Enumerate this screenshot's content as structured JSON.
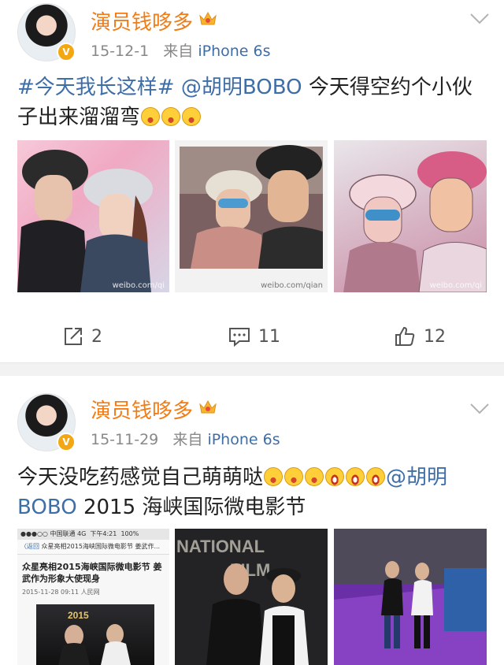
{
  "posts": [
    {
      "username": "演员钱哆多",
      "date": "15-12-1",
      "source_prefix": "来自",
      "source": "iPhone 6s",
      "text_hashtag": "#今天我长这样#",
      "text_mention": "@胡明BOBO",
      "text_body": "今天得空约个小伙子出来溜溜弯",
      "photo_watermarks": [
        "weibo.com/qi",
        "weibo.com/qian",
        "weibo.com/qi"
      ],
      "actions": {
        "repost": "2",
        "comment": "11",
        "like": "12"
      }
    },
    {
      "username": "演员钱哆多",
      "date": "15-11-29",
      "source_prefix": "来自",
      "source": "iPhone 6s",
      "text_body": "今天没吃药感觉自己萌萌哒",
      "text_mention": "@胡明BOBO",
      "text_tail": "2015 海峡国际微电影节",
      "phone_screenshot": {
        "status_carrier": "●●●○○ 中国联通 4G",
        "status_time": "下午4:21",
        "status_battery": "100%",
        "back_label": "〈返回",
        "nav_title": "众星亮相2015海峡国际微电影节 姜武作...",
        "headline": "众星亮相2015海峡国际微电影节 姜武作为形象大使现身",
        "article_date": "2015-11-28 09:11",
        "article_source": "人民网"
      }
    }
  ],
  "colors": {
    "username": "#f07d18",
    "link": "#3d6ea8",
    "meta": "#888888",
    "divider": "#f2f2f2"
  },
  "icons": {
    "repost": "share-box-icon",
    "comment": "comment-bubble-icon",
    "like": "thumbs-up-icon",
    "menu": "chevron-down-icon",
    "verified": "verified-v-icon",
    "vip": "crown-icon"
  }
}
